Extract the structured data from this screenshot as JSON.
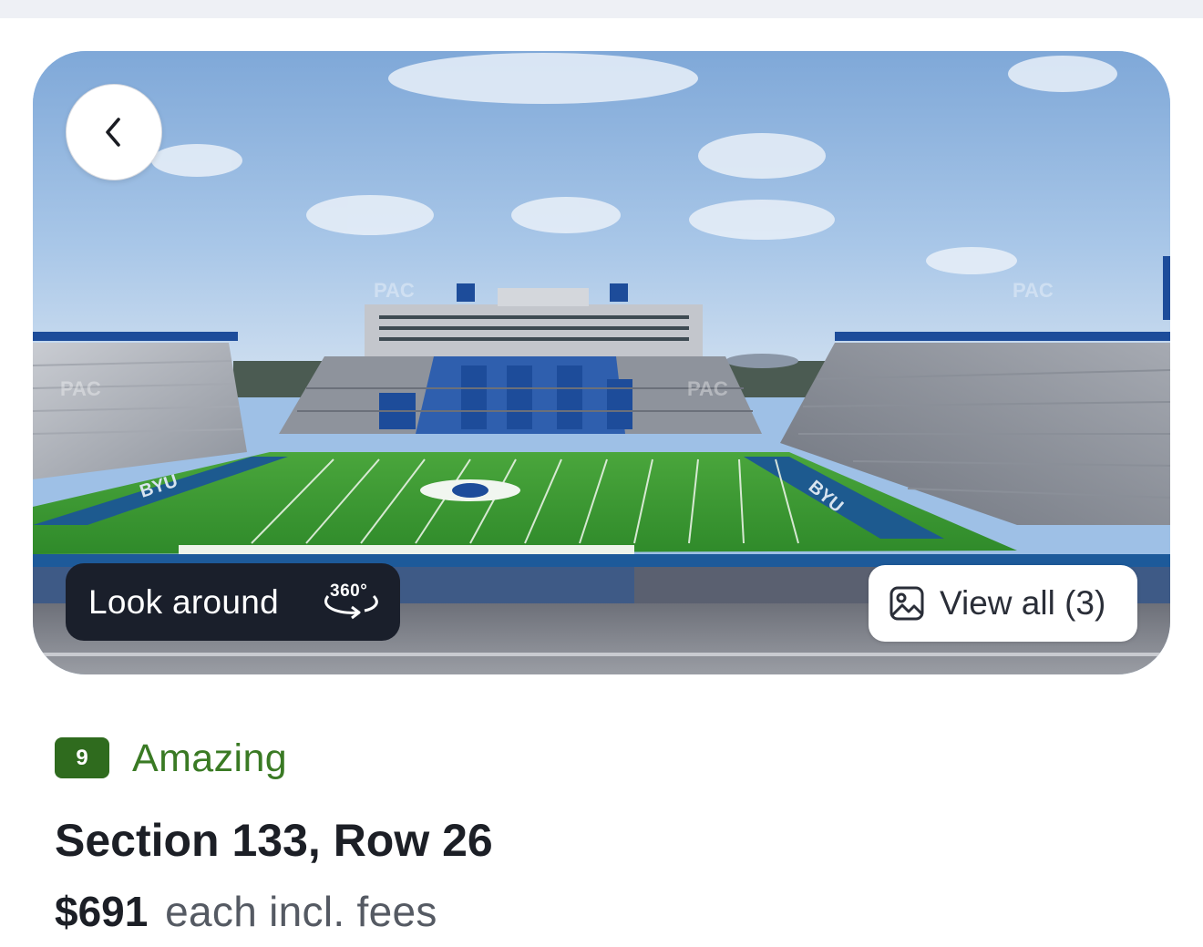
{
  "hero": {
    "image_alt": "BYU stadium view from the section",
    "watermark": "PAC",
    "end_zone_text": "BYU",
    "look_around_label": "Look around",
    "look_around_badge": "360°",
    "view_all_label": "View all (3)"
  },
  "listing": {
    "rating_score": "9",
    "rating_label": "Amazing",
    "title": "Section 133, Row 26",
    "price": "$691",
    "price_suffix": "each incl. fees"
  },
  "icons": {
    "back": "chevron-left-icon",
    "look_around": "rotate-360-icon",
    "view_all": "image-gallery-icon"
  },
  "colors": {
    "rating_badge": "#2f6b1e",
    "rating_text": "#3a7a24",
    "look_around_bg": "#1a1f2b",
    "field_green": "#3f9e35",
    "team_blue": "#1d4c9a"
  }
}
